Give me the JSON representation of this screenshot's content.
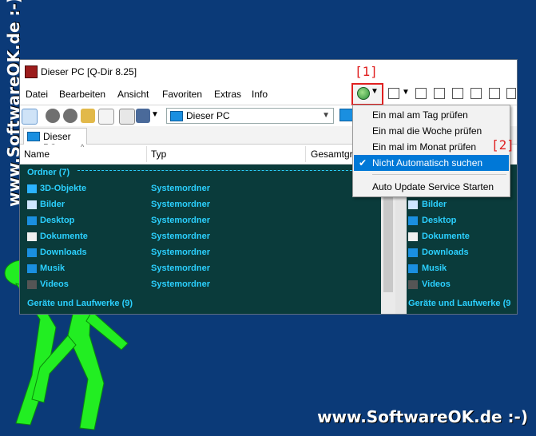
{
  "watermark": {
    "side": "www.SoftwareOK.de :-)",
    "bottom": "www.SoftwareOK.de :-)"
  },
  "window": {
    "title": "Dieser PC  [Q-Dir 8.25]"
  },
  "menubar": {
    "items": [
      "Datei",
      "Bearbeiten",
      "Ansicht",
      "Favoriten",
      "Extras",
      "Info"
    ]
  },
  "address": {
    "value": "Dieser PC"
  },
  "tab": {
    "label": "Dieser PC"
  },
  "columns": [
    "Name",
    "Typ",
    "Gesamtgr"
  ],
  "left_pane": {
    "group_folders": "Ordner (7)",
    "rows": [
      {
        "name": "3D-Objekte",
        "type": "Systemordner"
      },
      {
        "name": "Bilder",
        "type": "Systemordner"
      },
      {
        "name": "Desktop",
        "type": "Systemordner"
      },
      {
        "name": "Dokumente",
        "type": "Systemordner"
      },
      {
        "name": "Downloads",
        "type": "Systemordner"
      },
      {
        "name": "Musik",
        "type": "Systemordner"
      },
      {
        "name": "Videos",
        "type": "Systemordner"
      }
    ],
    "group_drives": "Geräte und Laufwerke (9)"
  },
  "right_pane": {
    "rows": [
      "Bilder",
      "Desktop",
      "Dokumente",
      "Downloads",
      "Musik",
      "Videos"
    ],
    "group_drives": "Geräte und Laufwerke (9"
  },
  "menu": {
    "items": [
      "Ein mal am Tag prüfen",
      "Ein mal die Woche prüfen",
      "Ein mal im Monat prüfen",
      "Nicht Automatisch suchen",
      "Auto Update Service Starten"
    ],
    "checked": "✔"
  },
  "callouts": {
    "one": "[1]",
    "two": "[2]"
  },
  "colors": {
    "accent": "#0078d7",
    "highlight_red": "#e02020",
    "pane_bg": "#0a3b3b",
    "pane_text": "#2bd0ff",
    "desktop_bg": "#0b3a78"
  }
}
